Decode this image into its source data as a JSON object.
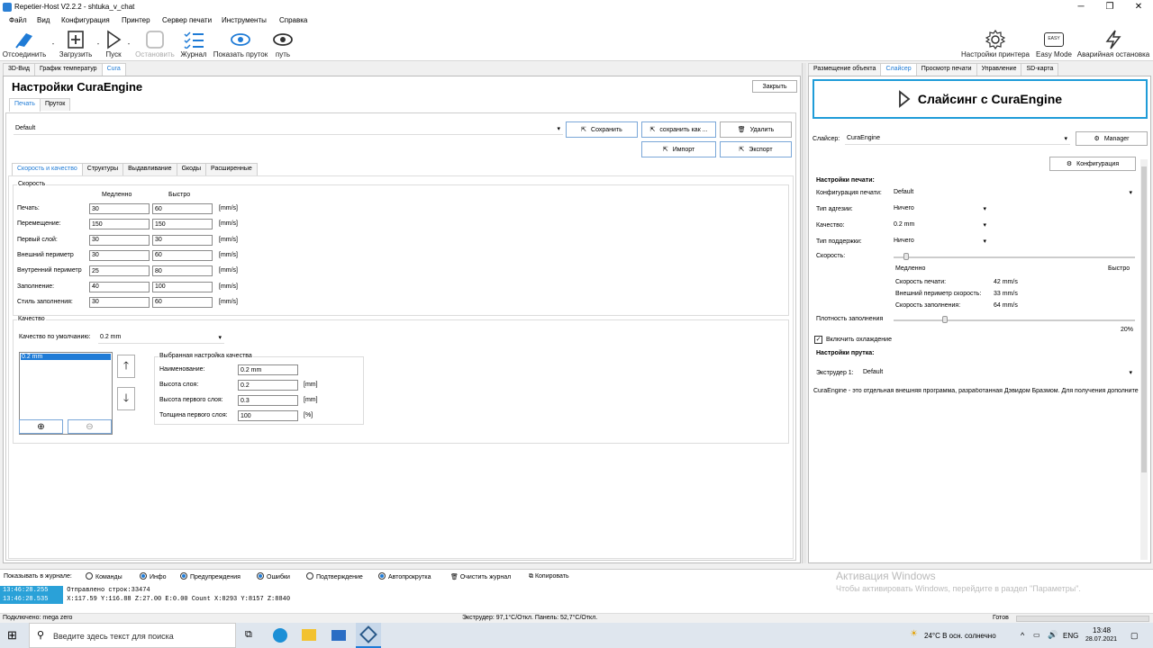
{
  "window": {
    "title": "Repetier-Host V2.2.2 - shtuka_v_chat"
  },
  "menu": [
    "Файл",
    "Вид",
    "Конфигурация",
    "Принтер",
    "Сервер печати",
    "Инструменты",
    "Справка"
  ],
  "toolbar": {
    "disconnect": "Отсоединить",
    "load": "Загрузить",
    "start": "Пуск",
    "stop": "Остановить",
    "log": "Журнал",
    "show_filament": "Показать пруток",
    "path": "путь",
    "printer_settings": "Настройки принтера",
    "easy_mode": "Easy Mode",
    "easy_icon_text": "EASY",
    "emergency": "Аварийная остановка"
  },
  "left_tabs": [
    "3D-Вид",
    "График температур",
    "Cura"
  ],
  "cura": {
    "title": "Настройки CuraEngine",
    "close": "Закрыть",
    "subtabs": [
      "Печать",
      "Пруток"
    ],
    "profile": "Default",
    "buttons": {
      "save": "Сохранить",
      "save_as": "сохранить как ...",
      "delete": "Удалить",
      "import": "Импорт",
      "export": "Экспорт"
    },
    "section_tabs": [
      "Скорость и качество",
      "Структуры",
      "Выдавливание",
      "Gкоды",
      "Расширенные"
    ],
    "speed": {
      "legend": "Скорость",
      "col_slow": "Медленно",
      "col_fast": "Быстро",
      "unit": "[mm/s]",
      "rows": [
        {
          "label": "Печать:",
          "slow": "30",
          "fast": "60"
        },
        {
          "label": "Перемещение:",
          "slow": "150",
          "fast": "150"
        },
        {
          "label": "Первый слой:",
          "slow": "30",
          "fast": "30"
        },
        {
          "label": "Внешний периметр",
          "slow": "30",
          "fast": "60"
        },
        {
          "label": "Внутренний периметр",
          "slow": "25",
          "fast": "80"
        },
        {
          "label": "Заполнение:",
          "slow": "40",
          "fast": "100"
        },
        {
          "label": "Стиль заполнения:",
          "slow": "30",
          "fast": "60"
        }
      ]
    },
    "quality": {
      "legend": "Качество",
      "default_label": "Качество по умолчанию:",
      "default_value": "0.2 mm",
      "list_item": "0.2 mm",
      "selected_legend": "Выбранная настройка качества",
      "name_label": "Наименование:",
      "name_value": "0.2 mm",
      "layer_label": "Высота слоя:",
      "layer_value": "0.2",
      "layer_unit": "[mm]",
      "first_layer_label": "Высота первого слоя:",
      "first_layer_value": "0.3",
      "first_layer_unit": "[mm]",
      "first_width_label": "Толщина первого слоя:",
      "first_width_value": "100",
      "first_width_unit": "[%]"
    }
  },
  "right_tabs": [
    "Размещение объекта",
    "Слайсер",
    "Просмотр печати",
    "Управление",
    "SD-карта"
  ],
  "slicer": {
    "big_button": "Слайсинг с CuraEngine",
    "slicer_label": "Слайсер:",
    "slicer_value": "CuraEngine",
    "manager": "Manager",
    "configuration": "Конфигурация",
    "print_settings": "Настройки печати:",
    "print_config_label": "Конфигурация печати:",
    "print_config_value": "Default",
    "adhesion_label": "Тип адгезии:",
    "adhesion_value": "Ничего",
    "quality_label": "Качество:",
    "quality_value": "0.2 mm",
    "support_label": "Тип поддержки:",
    "support_value": "Ничего",
    "speed_label": "Скорость:",
    "speed_slow": "Медленно",
    "speed_fast": "Быстро",
    "speed_level": 0.04,
    "print_speed_label": "Скорость печати:",
    "print_speed": "42 mm/s",
    "outer_speed_label": "Внешний периметр скорость:",
    "outer_speed": "33 mm/s",
    "fill_speed_label": "Скорость заполнения:",
    "fill_speed": "64 mm/s",
    "density_label": "Плотность заполнения",
    "density_value": "20%",
    "density_level": 0.2,
    "cooling": "Включить охлаждение",
    "filament_settings": "Настройки прутка:",
    "extruder_label": "Экструдер 1:",
    "extruder_value": "Default",
    "info": "CuraEngine - это отдельная внешняя программа, разработанная Дэвидом Бразмом. Для получения дополните"
  },
  "logbar": {
    "show_label": "Показывать в журнале:",
    "commands": "Команды",
    "info": "Инфо",
    "warnings": "Предупреждения",
    "errors": "Ошибки",
    "confirmations": "Подтверждение",
    "autoscroll": "Автопрокрутка",
    "clear": "Очистить журнал",
    "copy": "Копировать"
  },
  "log": [
    {
      "time": "13:46:28.255",
      "text": "Отправлено строк:33474"
    },
    {
      "time": "13:46:28.535",
      "text": "X:117.59 Y:116.88 Z:27.00 E:0.00 Count X:8293 Y:8157 Z:8840"
    }
  ],
  "activation": {
    "title": "Активация Windows",
    "text": "Чтобы активировать Windows, перейдите в раздел \"Параметры\"."
  },
  "status": {
    "connected": "Подключено: mega zero",
    "temps": "Экструдер: 97,1°C/Откл. Панель: 52,7°C/Откл.",
    "ready": "Готов"
  },
  "taskbar": {
    "search": "Введите здесь текст для поиска",
    "weather": "24°C  В осн. солнечно",
    "lang": "ENG",
    "time": "13:48",
    "date": "28.07.2021"
  },
  "colors": {
    "accent": "#1f7bd6",
    "log_ts": "#2aa1d8"
  }
}
